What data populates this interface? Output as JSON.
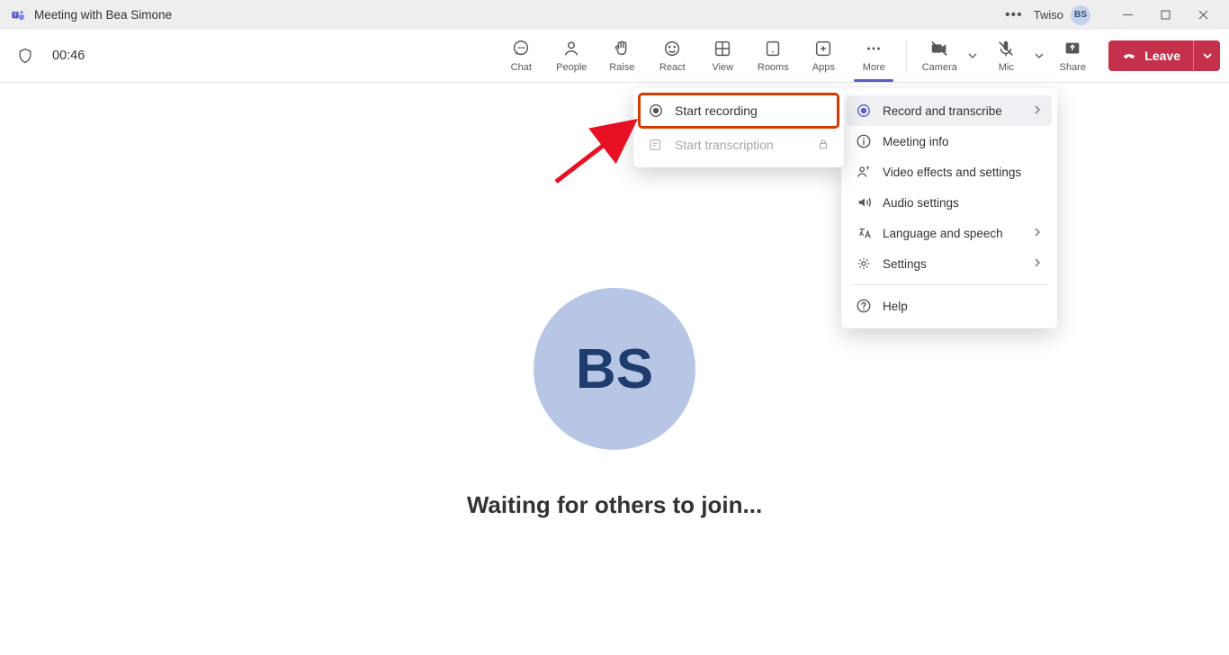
{
  "titlebar": {
    "meeting_title": "Meeting with Bea Simone",
    "user_name": "Twiso",
    "avatar_initials": "BS"
  },
  "toolbar": {
    "timer": "00:46",
    "buttons": {
      "chat": "Chat",
      "people": "People",
      "raise": "Raise",
      "react": "React",
      "view": "View",
      "rooms": "Rooms",
      "apps": "Apps",
      "more": "More",
      "camera": "Camera",
      "mic": "Mic",
      "share": "Share"
    },
    "leave_label": "Leave"
  },
  "stage": {
    "avatar_initials": "BS",
    "waiting_text": "Waiting for others to join..."
  },
  "more_menu": {
    "record_transcribe": "Record and transcribe",
    "meeting_info": "Meeting info",
    "video_effects": "Video effects and settings",
    "audio_settings": "Audio settings",
    "language_speech": "Language and speech",
    "settings": "Settings",
    "help": "Help"
  },
  "sub_menu": {
    "start_recording": "Start recording",
    "start_transcription": "Start transcription"
  },
  "colors": {
    "accent": "#5b5fc7",
    "leave": "#c4314b",
    "callout": "#d83b01"
  }
}
